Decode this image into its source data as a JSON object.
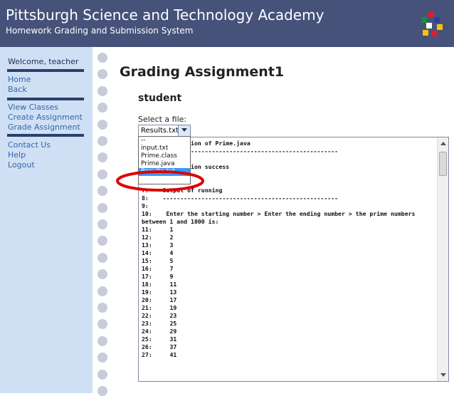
{
  "header": {
    "title": "Pittsburgh Science and Technology Academy",
    "subtitle": "Homework Grading and Submission System",
    "logo": "colored-squares-logo"
  },
  "sidebar": {
    "welcome": "Welcome, teacher",
    "links_group1": [
      "Home",
      "Back"
    ],
    "links_group2": [
      "View Classes",
      "Create Assignment",
      "Grade Assignment"
    ],
    "links_group3": [
      "Contact Us",
      "Help",
      "Logout"
    ]
  },
  "main": {
    "page_title": "Grading Assignment1",
    "section_title": "student",
    "select_label": "Select a file:",
    "selected_file": "Results.txt",
    "file_options": [
      "--",
      "input.txt",
      "Prime.class",
      "Prime.java",
      "Results.txt"
    ],
    "highlighted_option": "Results.txt"
  },
  "output_lines_top": [
    "1:    Compilation of Prime.java",
    "2:    --------------------------------------------------",
    "3:",
    "4:    Compilation success",
    "5:",
    "6:",
    "7:    Output of running",
    "8:    --------------------------------------------------",
    "9:",
    "10:    Enter the starting number > Enter the ending number > the prime numbers",
    "between 1 and 1000 is:"
  ],
  "output_numbered": [
    [
      "11:",
      "1"
    ],
    [
      "12:",
      "2"
    ],
    [
      "13:",
      "3"
    ],
    [
      "14:",
      "4"
    ],
    [
      "15:",
      "5"
    ],
    [
      "16:",
      "7"
    ],
    [
      "17:",
      "9"
    ],
    [
      "18:",
      "11"
    ],
    [
      "19:",
      "13"
    ],
    [
      "20:",
      "17"
    ],
    [
      "21:",
      "19"
    ],
    [
      "22:",
      "23"
    ],
    [
      "23:",
      "25"
    ],
    [
      "24:",
      "29"
    ],
    [
      "25:",
      "31"
    ],
    [
      "26:",
      "37"
    ],
    [
      "27:",
      "41"
    ]
  ],
  "colors": {
    "header_bg": "#46527a",
    "sidebar_bg": "#cfe0f5",
    "link": "#3366aa",
    "annotation": "#dd0000",
    "selection": "#3399ff"
  }
}
